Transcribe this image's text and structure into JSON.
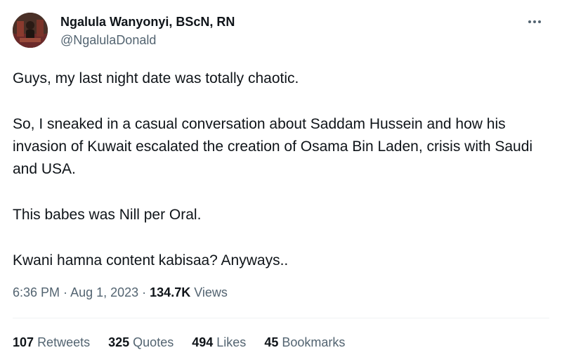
{
  "author": {
    "display_name": "Ngalula Wanyonyi, BScN, RN",
    "handle": "@NgalulaDonald"
  },
  "tweet": {
    "paragraphs": [
      "Guys, my last night date was totally chaotic.",
      "So, I sneaked in a casual conversation about Saddam Hussein and how his invasion of Kuwait escalated the creation of Osama Bin Laden, crisis with Saudi and USA.",
      "This babes was Nill per Oral.",
      "Kwani hamna content kabisaa? Anyways.."
    ]
  },
  "meta": {
    "time": "6:36 PM",
    "separator": " · ",
    "date": "Aug 1, 2023",
    "views_count": "134.7K",
    "views_label": " Views"
  },
  "stats": {
    "retweets": {
      "count": "107",
      "label": "Retweets"
    },
    "quotes": {
      "count": "325",
      "label": "Quotes"
    },
    "likes": {
      "count": "494",
      "label": "Likes"
    },
    "bookmarks": {
      "count": "45",
      "label": "Bookmarks"
    }
  },
  "icons": {
    "more": "more-horizontal-icon"
  },
  "colors": {
    "text": "#0f1419",
    "secondary": "#536471",
    "divider": "#eff3f4"
  }
}
